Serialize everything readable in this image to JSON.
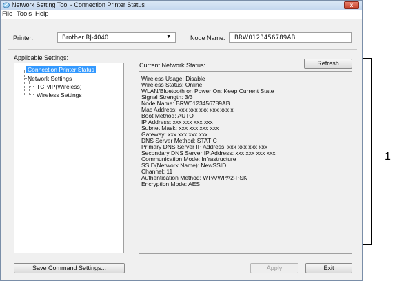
{
  "window": {
    "title": "Network Setting Tool - Connection Printer Status",
    "close_glyph": "x"
  },
  "menu": [
    "File",
    "Tools",
    "Help"
  ],
  "printer": {
    "label": "Printer:",
    "value": "Brother RJ-4040"
  },
  "node": {
    "label": "Node Name:",
    "value": "BRW0123456789AB"
  },
  "applicable_settings": {
    "label": "Applicable Settings:",
    "tree": [
      {
        "label": "Connection Printer Status",
        "selected": true
      },
      {
        "label": "Network Settings"
      },
      {
        "label": "TCP/IP(Wireless)"
      },
      {
        "label": "Wireless Settings"
      }
    ]
  },
  "status": {
    "label": "Current Network Status:",
    "refresh_label": "Refresh",
    "lines": [
      "Wireless Usage: Disable",
      "Wireless Status: Online",
      "WLAN/Bluetooth on Power On: Keep Current State",
      "Signal Strength: 3/3",
      "Node Name: BRW0123456789AB",
      "Mac Address: xxx xxx xxx xxx xxx x",
      "Boot Method: AUTO",
      "IP Address: xxx xxx xxx xxx",
      "Subnet Mask: xxx xxx xxx xxx",
      "Gateway: xxx xxx xxx xxx",
      "DNS Server Method: STATIC",
      "Primary DNS Server IP Address: xxx xxx xxx xxx",
      "Secondary DNS Server IP Address: xxx xxx xxx xxx",
      "Communication Mode: Infrastructure",
      "SSID(Network Name): NewSSID",
      "Channel: 11",
      "Authentication Method: WPA/WPA2-PSK",
      "Encryption Mode: AES"
    ]
  },
  "buttons": {
    "save": "Save Command Settings...",
    "apply": "Apply",
    "exit": "Exit"
  },
  "callout": {
    "number": "1"
  }
}
